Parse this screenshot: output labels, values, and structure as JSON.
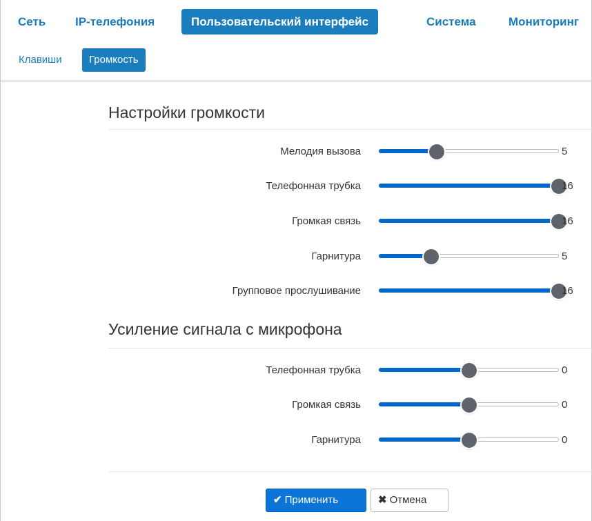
{
  "nav": {
    "main_tabs": [
      {
        "label": "Сеть",
        "active": false
      },
      {
        "label": "IP-телефония",
        "active": false
      },
      {
        "label": "Пользовательский интерфейс",
        "active": true
      },
      {
        "label": "Система",
        "active": false
      },
      {
        "label": "Мониторинг",
        "active": false
      }
    ],
    "sub_tabs": [
      {
        "label": "Клавиши",
        "active": false
      },
      {
        "label": "Громкость",
        "active": true
      }
    ]
  },
  "volume": {
    "title": "Настройки громкости",
    "sliders": [
      {
        "label": "Мелодия вызова",
        "value": "5",
        "level": 0.32
      },
      {
        "label": "Телефонная трубка",
        "value": "16",
        "level": 1.0
      },
      {
        "label": "Громкая связь",
        "value": "16",
        "level": 1.0
      },
      {
        "label": "Гарнитура",
        "value": "5",
        "level": 0.29
      },
      {
        "label": "Групповое прослушивание",
        "value": "16",
        "level": 1.0
      }
    ]
  },
  "mic": {
    "title": "Усиление сигнала с микрофона",
    "sliders": [
      {
        "label": "Телефонная трубка",
        "value": "0",
        "level": 0.5
      },
      {
        "label": "Громкая связь",
        "value": "0",
        "level": 0.5
      },
      {
        "label": "Гарнитура",
        "value": "0",
        "level": 0.5
      }
    ]
  },
  "buttons": {
    "apply_icon": "check-icon",
    "apply_label": "Применить",
    "cancel_icon": "x-icon",
    "cancel_label": "Отмена"
  },
  "colors": {
    "accent": "#1a7dbe",
    "slider_fill": "#0066cc",
    "thumb": "#5f636c"
  }
}
